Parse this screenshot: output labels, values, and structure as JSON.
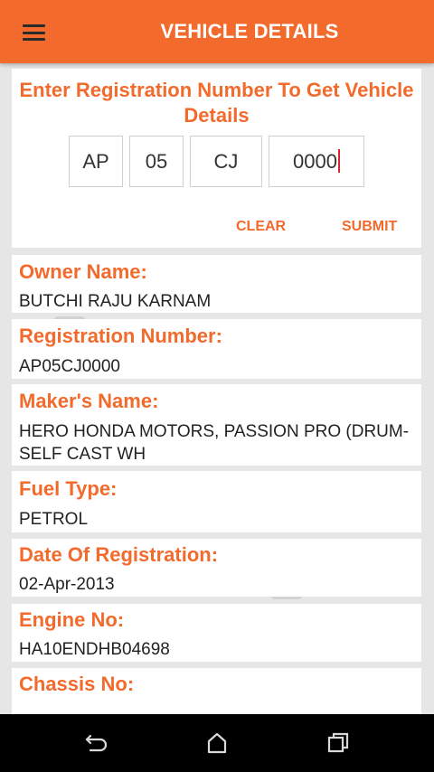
{
  "app": {
    "title": "VEHICLE DETAILS",
    "accent_color": "#f26a2c"
  },
  "search": {
    "prompt": "Enter Registration Number To Get Vehicle Details",
    "fields": {
      "state": "AP",
      "district": "05",
      "series": "CJ",
      "number": "0000"
    },
    "clear_label": "CLEAR",
    "submit_label": "SUBMIT"
  },
  "details": [
    {
      "label": "Owner Name:",
      "value": "BUTCHI RAJU KARNAM"
    },
    {
      "label": "Registration Number:",
      "value": "AP05CJ0000"
    },
    {
      "label": "Maker's Name:",
      "value": "HERO HONDA MOTORS, PASSION PRO (DRUM-SELF CAST WH"
    },
    {
      "label": "Fuel Type:",
      "value": "PETROL"
    },
    {
      "label": "Date Of Registration:",
      "value": "02-Apr-2013"
    },
    {
      "label": "Engine No:",
      "value": "HA10ENDHB04698"
    },
    {
      "label": "Chassis No:",
      "value": ""
    }
  ],
  "nav": {
    "icons": [
      "back-icon",
      "home-icon",
      "recents-icon"
    ]
  }
}
